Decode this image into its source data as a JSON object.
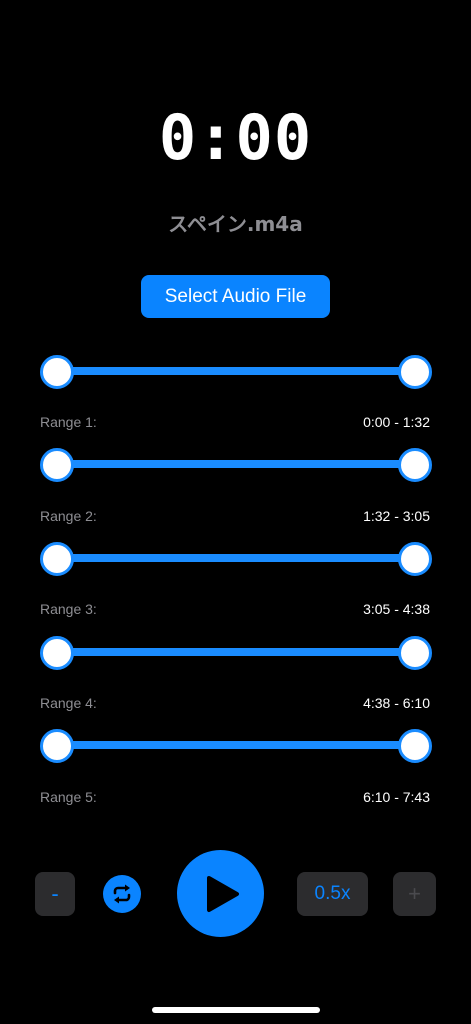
{
  "player": {
    "time": "0:00",
    "filename": "スペイン.m4a",
    "select_button_label": "Select Audio File"
  },
  "ranges": [
    {
      "label": "Range 1:",
      "value": "0:00 - 1:32"
    },
    {
      "label": "Range 2:",
      "value": "1:32 - 3:05"
    },
    {
      "label": "Range 3:",
      "value": "3:05 - 4:38"
    },
    {
      "label": "Range 4:",
      "value": "4:38 - 6:10"
    },
    {
      "label": "Range 5:",
      "value": "6:10 - 7:43"
    }
  ],
  "controls": {
    "minus_label": "-",
    "speed_label": "0.5x",
    "plus_label": "+",
    "repeat_icon": "repeat-icon",
    "play_icon": "play-icon"
  },
  "colors": {
    "accent": "#0a84ff",
    "background": "#000000",
    "secondary_text": "#8e8e93",
    "control_bg": "#2c2c2e"
  }
}
